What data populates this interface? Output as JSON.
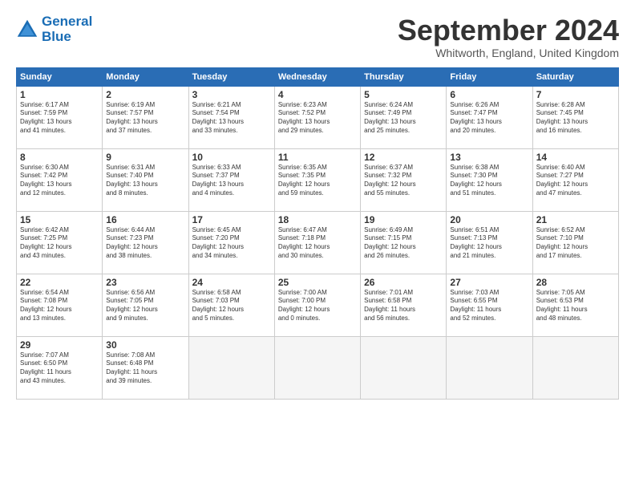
{
  "header": {
    "logo_line1": "General",
    "logo_line2": "Blue",
    "title": "September 2024",
    "location": "Whitworth, England, United Kingdom"
  },
  "days_of_week": [
    "Sunday",
    "Monday",
    "Tuesday",
    "Wednesday",
    "Thursday",
    "Friday",
    "Saturday"
  ],
  "weeks": [
    [
      {
        "day": "1",
        "lines": [
          "Sunrise: 6:17 AM",
          "Sunset: 7:59 PM",
          "Daylight: 13 hours",
          "and 41 minutes."
        ]
      },
      {
        "day": "2",
        "lines": [
          "Sunrise: 6:19 AM",
          "Sunset: 7:57 PM",
          "Daylight: 13 hours",
          "and 37 minutes."
        ]
      },
      {
        "day": "3",
        "lines": [
          "Sunrise: 6:21 AM",
          "Sunset: 7:54 PM",
          "Daylight: 13 hours",
          "and 33 minutes."
        ]
      },
      {
        "day": "4",
        "lines": [
          "Sunrise: 6:23 AM",
          "Sunset: 7:52 PM",
          "Daylight: 13 hours",
          "and 29 minutes."
        ]
      },
      {
        "day": "5",
        "lines": [
          "Sunrise: 6:24 AM",
          "Sunset: 7:49 PM",
          "Daylight: 13 hours",
          "and 25 minutes."
        ]
      },
      {
        "day": "6",
        "lines": [
          "Sunrise: 6:26 AM",
          "Sunset: 7:47 PM",
          "Daylight: 13 hours",
          "and 20 minutes."
        ]
      },
      {
        "day": "7",
        "lines": [
          "Sunrise: 6:28 AM",
          "Sunset: 7:45 PM",
          "Daylight: 13 hours",
          "and 16 minutes."
        ]
      }
    ],
    [
      {
        "day": "8",
        "lines": [
          "Sunrise: 6:30 AM",
          "Sunset: 7:42 PM",
          "Daylight: 13 hours",
          "and 12 minutes."
        ]
      },
      {
        "day": "9",
        "lines": [
          "Sunrise: 6:31 AM",
          "Sunset: 7:40 PM",
          "Daylight: 13 hours",
          "and 8 minutes."
        ]
      },
      {
        "day": "10",
        "lines": [
          "Sunrise: 6:33 AM",
          "Sunset: 7:37 PM",
          "Daylight: 13 hours",
          "and 4 minutes."
        ]
      },
      {
        "day": "11",
        "lines": [
          "Sunrise: 6:35 AM",
          "Sunset: 7:35 PM",
          "Daylight: 12 hours",
          "and 59 minutes."
        ]
      },
      {
        "day": "12",
        "lines": [
          "Sunrise: 6:37 AM",
          "Sunset: 7:32 PM",
          "Daylight: 12 hours",
          "and 55 minutes."
        ]
      },
      {
        "day": "13",
        "lines": [
          "Sunrise: 6:38 AM",
          "Sunset: 7:30 PM",
          "Daylight: 12 hours",
          "and 51 minutes."
        ]
      },
      {
        "day": "14",
        "lines": [
          "Sunrise: 6:40 AM",
          "Sunset: 7:27 PM",
          "Daylight: 12 hours",
          "and 47 minutes."
        ]
      }
    ],
    [
      {
        "day": "15",
        "lines": [
          "Sunrise: 6:42 AM",
          "Sunset: 7:25 PM",
          "Daylight: 12 hours",
          "and 43 minutes."
        ]
      },
      {
        "day": "16",
        "lines": [
          "Sunrise: 6:44 AM",
          "Sunset: 7:23 PM",
          "Daylight: 12 hours",
          "and 38 minutes."
        ]
      },
      {
        "day": "17",
        "lines": [
          "Sunrise: 6:45 AM",
          "Sunset: 7:20 PM",
          "Daylight: 12 hours",
          "and 34 minutes."
        ]
      },
      {
        "day": "18",
        "lines": [
          "Sunrise: 6:47 AM",
          "Sunset: 7:18 PM",
          "Daylight: 12 hours",
          "and 30 minutes."
        ]
      },
      {
        "day": "19",
        "lines": [
          "Sunrise: 6:49 AM",
          "Sunset: 7:15 PM",
          "Daylight: 12 hours",
          "and 26 minutes."
        ]
      },
      {
        "day": "20",
        "lines": [
          "Sunrise: 6:51 AM",
          "Sunset: 7:13 PM",
          "Daylight: 12 hours",
          "and 21 minutes."
        ]
      },
      {
        "day": "21",
        "lines": [
          "Sunrise: 6:52 AM",
          "Sunset: 7:10 PM",
          "Daylight: 12 hours",
          "and 17 minutes."
        ]
      }
    ],
    [
      {
        "day": "22",
        "lines": [
          "Sunrise: 6:54 AM",
          "Sunset: 7:08 PM",
          "Daylight: 12 hours",
          "and 13 minutes."
        ]
      },
      {
        "day": "23",
        "lines": [
          "Sunrise: 6:56 AM",
          "Sunset: 7:05 PM",
          "Daylight: 12 hours",
          "and 9 minutes."
        ]
      },
      {
        "day": "24",
        "lines": [
          "Sunrise: 6:58 AM",
          "Sunset: 7:03 PM",
          "Daylight: 12 hours",
          "and 5 minutes."
        ]
      },
      {
        "day": "25",
        "lines": [
          "Sunrise: 7:00 AM",
          "Sunset: 7:00 PM",
          "Daylight: 12 hours",
          "and 0 minutes."
        ]
      },
      {
        "day": "26",
        "lines": [
          "Sunrise: 7:01 AM",
          "Sunset: 6:58 PM",
          "Daylight: 11 hours",
          "and 56 minutes."
        ]
      },
      {
        "day": "27",
        "lines": [
          "Sunrise: 7:03 AM",
          "Sunset: 6:55 PM",
          "Daylight: 11 hours",
          "and 52 minutes."
        ]
      },
      {
        "day": "28",
        "lines": [
          "Sunrise: 7:05 AM",
          "Sunset: 6:53 PM",
          "Daylight: 11 hours",
          "and 48 minutes."
        ]
      }
    ],
    [
      {
        "day": "29",
        "lines": [
          "Sunrise: 7:07 AM",
          "Sunset: 6:50 PM",
          "Daylight: 11 hours",
          "and 43 minutes."
        ]
      },
      {
        "day": "30",
        "lines": [
          "Sunrise: 7:08 AM",
          "Sunset: 6:48 PM",
          "Daylight: 11 hours",
          "and 39 minutes."
        ]
      },
      {
        "day": "",
        "lines": [],
        "empty": true
      },
      {
        "day": "",
        "lines": [],
        "empty": true
      },
      {
        "day": "",
        "lines": [],
        "empty": true
      },
      {
        "day": "",
        "lines": [],
        "empty": true
      },
      {
        "day": "",
        "lines": [],
        "empty": true
      }
    ]
  ]
}
